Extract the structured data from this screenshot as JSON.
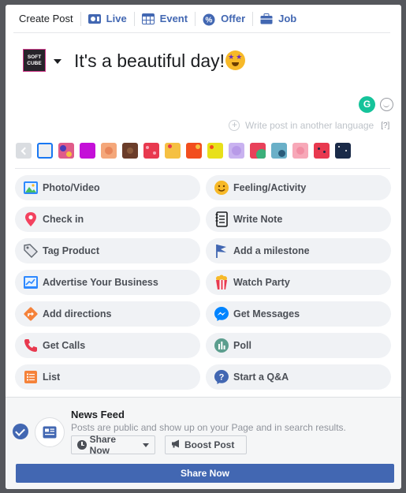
{
  "tabs": [
    {
      "label": "Create Post",
      "icon": "none"
    },
    {
      "label": "Live",
      "icon": "video-camera-icon"
    },
    {
      "label": "Event",
      "icon": "calendar-icon"
    },
    {
      "label": "Offer",
      "icon": "percent-tag-icon"
    },
    {
      "label": "Job",
      "icon": "briefcase-icon"
    }
  ],
  "composer": {
    "avatar_line1": "SOFT",
    "avatar_line2": "CUBE",
    "text": "It's a beautiful day!",
    "emoji": "star-struck-emoji"
  },
  "language": {
    "label": "Write post in another language",
    "help": "[?]"
  },
  "backgrounds": {
    "selected_index": 0,
    "swatches": [
      "#eceef1",
      "#e05b8a",
      "#c410d8",
      "#f4a77a",
      "#6b3d2a",
      "#e8394f",
      "#f5c042",
      "#f24e1e",
      "#e8e01a",
      "#c9b2f0",
      "#e8415a",
      "#6ab0c8",
      "#f7a8b8",
      "#e8394f",
      "#1a2a48"
    ]
  },
  "actions": [
    {
      "label": "Photo/Video",
      "icon": "photo-icon",
      "color": "#45bd62"
    },
    {
      "label": "Feeling/Activity",
      "icon": "smiley-icon",
      "color": "#f7b928"
    },
    {
      "label": "Check in",
      "icon": "map-pin-icon",
      "color": "#f3425f"
    },
    {
      "label": "Write Note",
      "icon": "notebook-icon",
      "color": "#1c1e21"
    },
    {
      "label": "Tag Product",
      "icon": "tag-icon",
      "color": "#606770"
    },
    {
      "label": "Add a milestone",
      "icon": "flag-icon",
      "color": "#4267b2"
    },
    {
      "label": "Advertise Your Business",
      "icon": "advertise-icon",
      "color": "#2d88ff"
    },
    {
      "label": "Watch Party",
      "icon": "popcorn-icon",
      "color": "#e8394f"
    },
    {
      "label": "Add directions",
      "icon": "directions-icon",
      "color": "#f5823a"
    },
    {
      "label": "Get Messages",
      "icon": "messenger-icon",
      "color": "#0084ff"
    },
    {
      "label": "Get Calls",
      "icon": "phone-icon",
      "color": "#e8394f"
    },
    {
      "label": "Poll",
      "icon": "poll-icon",
      "color": "#5c9e8e"
    },
    {
      "label": "List",
      "icon": "list-icon",
      "color": "#f5823a"
    },
    {
      "label": "Start a Q&A",
      "icon": "question-icon",
      "color": "#4267b2"
    }
  ],
  "footer": {
    "title": "News Feed",
    "description": "Posts are public and show up on your Page and in search results.",
    "share_now": "Share Now",
    "boost_post": "Boost Post",
    "primary": "Share Now"
  },
  "colors": {
    "accent": "#4267b2",
    "button_bg": "#f0f2f5"
  }
}
